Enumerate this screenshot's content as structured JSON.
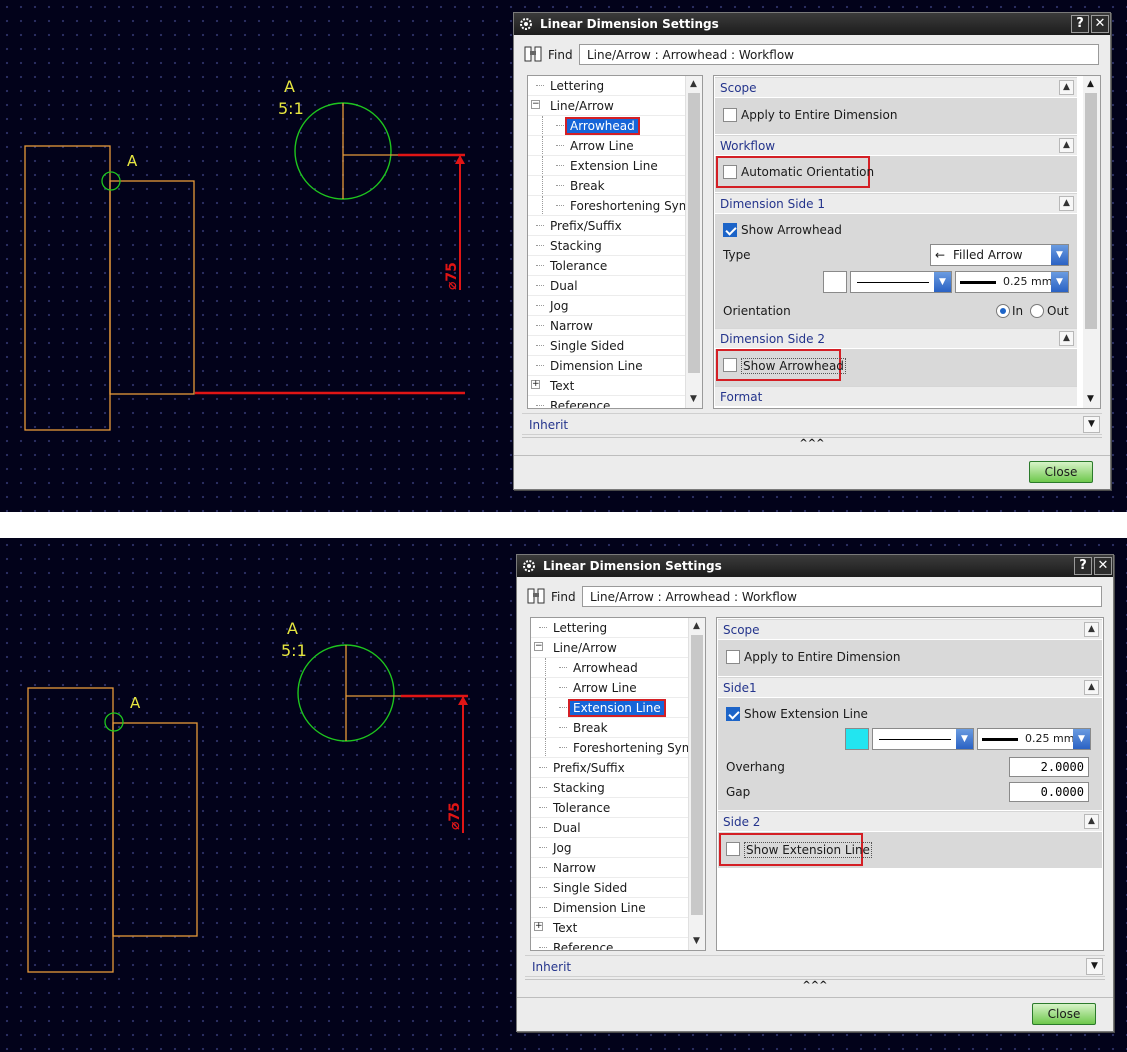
{
  "panels": [
    {
      "cad": {
        "view_label": "A",
        "scale_label": "5:1",
        "point_label": "A",
        "dimension_text": "⌀75"
      },
      "dialog": {
        "title": "Linear Dimension Settings",
        "help_button": "?",
        "close_x": "✕",
        "find_label": "Find",
        "find_value": "Line/Arrow : Arrowhead : Workflow",
        "tree": [
          {
            "label": "Lettering",
            "level": 0,
            "selected": false,
            "highlighted": false
          },
          {
            "label": "Line/Arrow",
            "level": 0,
            "expanded": true,
            "selected": false,
            "highlighted": false
          },
          {
            "label": "Arrowhead",
            "level": 1,
            "selected": true,
            "highlighted": true
          },
          {
            "label": "Arrow Line",
            "level": 1,
            "selected": false,
            "highlighted": false
          },
          {
            "label": "Extension Line",
            "level": 1,
            "selected": false,
            "highlighted": false
          },
          {
            "label": "Break",
            "level": 1,
            "selected": false,
            "highlighted": false
          },
          {
            "label": "Foreshortening Symbo",
            "level": 1,
            "selected": false,
            "highlighted": false
          },
          {
            "label": "Prefix/Suffix",
            "level": 0,
            "selected": false,
            "highlighted": false
          },
          {
            "label": "Stacking",
            "level": 0,
            "selected": false,
            "highlighted": false
          },
          {
            "label": "Tolerance",
            "level": 0,
            "selected": false,
            "highlighted": false
          },
          {
            "label": "Dual",
            "level": 0,
            "selected": false,
            "highlighted": false
          },
          {
            "label": "Jog",
            "level": 0,
            "selected": false,
            "highlighted": false
          },
          {
            "label": "Narrow",
            "level": 0,
            "selected": false,
            "highlighted": false
          },
          {
            "label": "Single Sided",
            "level": 0,
            "selected": false,
            "highlighted": false
          },
          {
            "label": "Dimension Line",
            "level": 0,
            "selected": false,
            "highlighted": false
          },
          {
            "label": "Text",
            "level": 0,
            "expandable": true,
            "selected": false,
            "highlighted": false
          },
          {
            "label": "Reference",
            "level": 0,
            "selected": false,
            "highlighted": false
          }
        ],
        "sections": {
          "scope": "Scope",
          "apply_entire": "Apply to Entire Dimension",
          "workflow": "Workflow",
          "auto_orientation": "Automatic Orientation",
          "side1": "Dimension Side 1",
          "show_arrowhead_1": "Show Arrowhead",
          "type_label": "Type",
          "type_value": "Filled Arrow",
          "line_width": "0.25 mm",
          "orientation_label": "Orientation",
          "radio_in": "In",
          "radio_out": "Out",
          "side2": "Dimension Side 2",
          "show_arrowhead_2": "Show Arrowhead",
          "format": "Format"
        },
        "inherit": "Inherit",
        "more": "^^^",
        "close_button": "Close"
      }
    },
    {
      "cad": {
        "view_label": "A",
        "scale_label": "5:1",
        "point_label": "A",
        "dimension_text": "⌀75"
      },
      "dialog": {
        "title": "Linear Dimension Settings",
        "help_button": "?",
        "close_x": "✕",
        "find_label": "Find",
        "find_value": "Line/Arrow : Arrowhead : Workflow",
        "tree": [
          {
            "label": "Lettering",
            "level": 0,
            "selected": false,
            "highlighted": false
          },
          {
            "label": "Line/Arrow",
            "level": 0,
            "expanded": true,
            "selected": false,
            "highlighted": false
          },
          {
            "label": "Arrowhead",
            "level": 1,
            "selected": false,
            "highlighted": false
          },
          {
            "label": "Arrow Line",
            "level": 1,
            "selected": false,
            "highlighted": false
          },
          {
            "label": "Extension Line",
            "level": 1,
            "selected": true,
            "highlighted": true
          },
          {
            "label": "Break",
            "level": 1,
            "selected": false,
            "highlighted": false
          },
          {
            "label": "Foreshortening Symbo",
            "level": 1,
            "selected": false,
            "highlighted": false
          },
          {
            "label": "Prefix/Suffix",
            "level": 0,
            "selected": false,
            "highlighted": false
          },
          {
            "label": "Stacking",
            "level": 0,
            "selected": false,
            "highlighted": false
          },
          {
            "label": "Tolerance",
            "level": 0,
            "selected": false,
            "highlighted": false
          },
          {
            "label": "Dual",
            "level": 0,
            "selected": false,
            "highlighted": false
          },
          {
            "label": "Jog",
            "level": 0,
            "selected": false,
            "highlighted": false
          },
          {
            "label": "Narrow",
            "level": 0,
            "selected": false,
            "highlighted": false
          },
          {
            "label": "Single Sided",
            "level": 0,
            "selected": false,
            "highlighted": false
          },
          {
            "label": "Dimension Line",
            "level": 0,
            "selected": false,
            "highlighted": false
          },
          {
            "label": "Text",
            "level": 0,
            "expandable": true,
            "selected": false,
            "highlighted": false
          },
          {
            "label": "Reference",
            "level": 0,
            "selected": false,
            "highlighted": false
          }
        ],
        "sections": {
          "scope": "Scope",
          "apply_entire": "Apply to Entire Dimension",
          "side1": "Side1",
          "show_ext_1": "Show Extension Line",
          "ext_color": "#22e5f0",
          "line_width": "0.25 mm",
          "overhang_label": "Overhang",
          "overhang_value": "2.0000",
          "gap_label": "Gap",
          "gap_value": "0.0000",
          "side2": "Side 2",
          "show_ext_2": "Show Extension Line"
        },
        "inherit": "Inherit",
        "more": "^^^",
        "close_button": "Close"
      }
    }
  ],
  "colors": {
    "background": "#02021a",
    "geometry_orange": "#e69a3a",
    "circle_green": "#1ec51e",
    "dimension_red": "#e01515",
    "label_yellow": "#e6e640",
    "highlight_red": "#d41f25",
    "selection_blue": "#1665d8"
  }
}
